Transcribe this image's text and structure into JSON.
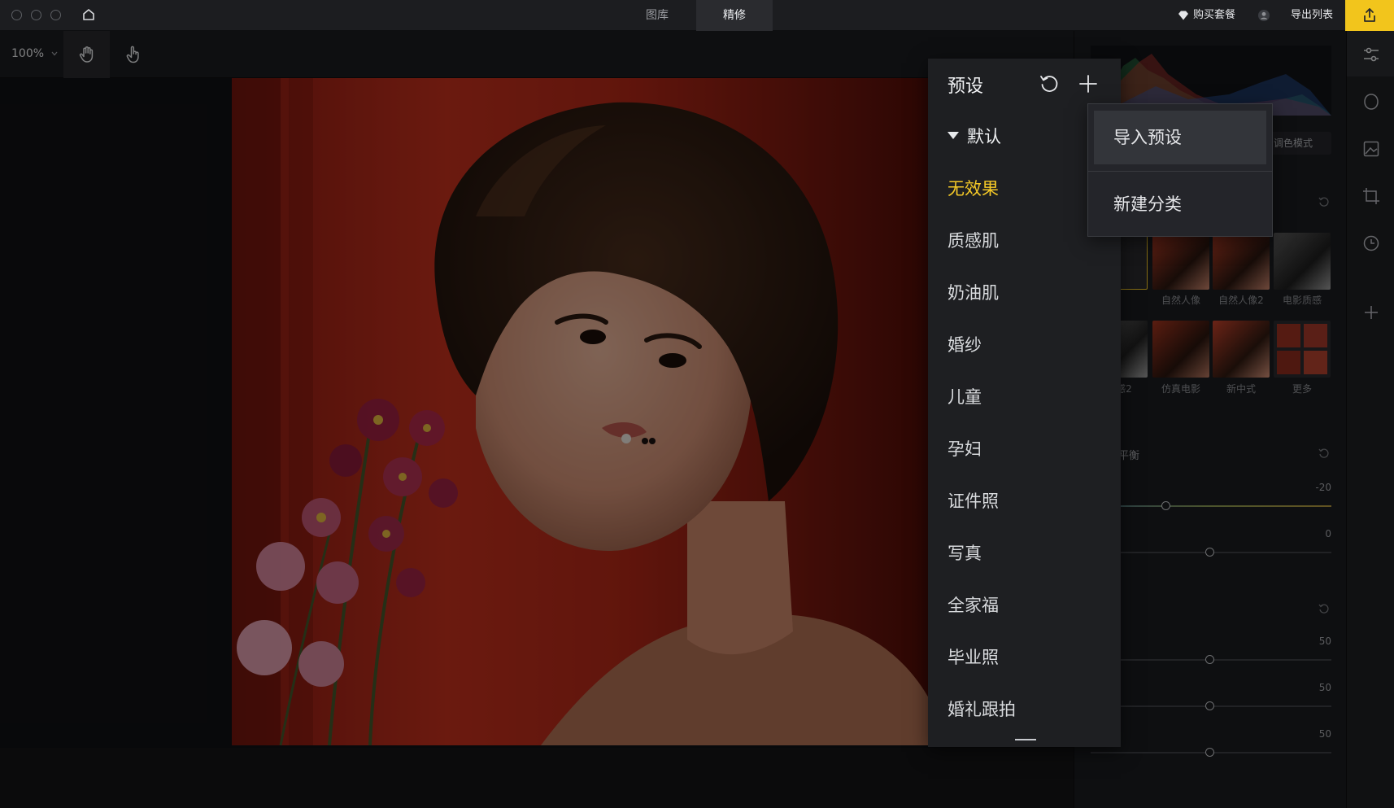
{
  "titlebar": {
    "tabs": [
      {
        "label": "图库"
      },
      {
        "label": "精修"
      }
    ],
    "active_tab": "精修",
    "buy_package_label": "购买套餐",
    "export_list_label": "导出列表"
  },
  "toolbar": {
    "zoom_label": "100%"
  },
  "right_panel": {
    "mode_button_label": "调色模式",
    "preset_thumbnails": [
      {
        "label": "自然人像"
      },
      {
        "label": "自然人像2"
      },
      {
        "label": "电影质感"
      },
      {
        "label": "质感2"
      },
      {
        "label": "仿真电影"
      },
      {
        "label": "新中式"
      },
      {
        "label": "更多"
      }
    ],
    "balance_label": "平衡",
    "slider_values": [
      "-20",
      "0",
      "50",
      "50",
      "50"
    ]
  },
  "preset_menu": {
    "title": "预设",
    "group_label": "默认",
    "items": [
      {
        "label": "无效果",
        "selected": true
      },
      {
        "label": "质感肌"
      },
      {
        "label": "奶油肌"
      },
      {
        "label": "婚纱"
      },
      {
        "label": "儿童"
      },
      {
        "label": "孕妇"
      },
      {
        "label": "证件照"
      },
      {
        "label": "写真"
      },
      {
        "label": "全家福"
      },
      {
        "label": "毕业照"
      },
      {
        "label": "婚礼跟拍"
      }
    ]
  },
  "add_menu": {
    "items": [
      {
        "label": "导入预设"
      },
      {
        "label": "新建分类"
      }
    ]
  },
  "colors": {
    "accent": "#f5c927",
    "export_button": "#f2c51c",
    "panel_bg": "#1e1f22"
  },
  "icons": {
    "hand_tool": "hand-icon",
    "pointer_tool": "pointer-hand-icon",
    "reset": "reset-icon",
    "add": "plus-icon",
    "rail": [
      "adjustments-icon",
      "face-icon",
      "image-icon",
      "crop-icon",
      "history-icon",
      "plus-icon"
    ]
  }
}
